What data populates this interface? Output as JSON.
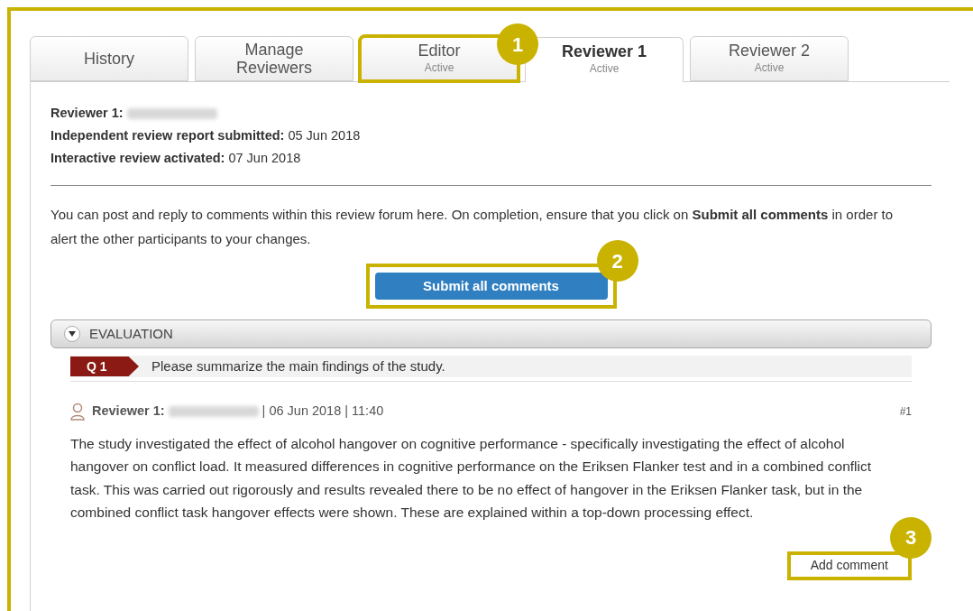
{
  "tabs": [
    {
      "label": "History",
      "selected": false
    },
    {
      "label": "Manage Reviewers",
      "selected": false
    },
    {
      "label": "Editor",
      "sublabel": "Active",
      "selected": false,
      "callout": "1"
    },
    {
      "label": "Reviewer 1",
      "sublabel": "Active",
      "selected": true
    },
    {
      "label": "Reviewer 2",
      "sublabel": "Active",
      "selected": false
    }
  ],
  "info": [
    {
      "label": "Reviewer 1:",
      "redacted": true
    },
    {
      "label": "Independent review report submitted:",
      "value": "05 Jun 2018",
      "redacted": false
    },
    {
      "label": "Interactive review activated:",
      "value": "07 Jun 2018",
      "redacted": false
    }
  ],
  "instructions": "You can post and reply to comments within this review forum here. On completion, ensure that you click on **Submit all comments** in order to alert the other participants to your changes.",
  "submit_button": {
    "label": "Submit all comments",
    "callout": "2"
  },
  "section": {
    "title": "EVALUATION",
    "expanded": true
  },
  "question": {
    "number": "Q 1",
    "text": "Please summarize the main findings of the study."
  },
  "comment": {
    "author_label": "Reviewer 1:",
    "author_redacted": true,
    "timestamp": "| 06 Jun 2018 | 11:40",
    "index": "#1",
    "body": "The study investigated the effect of alcohol hangover on cognitive performance - specifically investigating the effect of alcohol hangover on conflict load. It measured differences in cognitive performance on the Eriksen Flanker test and in a combined conflict task. This was carried out rigorously and results revealed there to be no effect of hangover in the Eriksen Flanker task, but in the combined conflict task hangover effects were shown. These are explained within a top-down processing effect."
  },
  "add_comment_button": {
    "label": "Add comment",
    "callout": "3"
  }
}
